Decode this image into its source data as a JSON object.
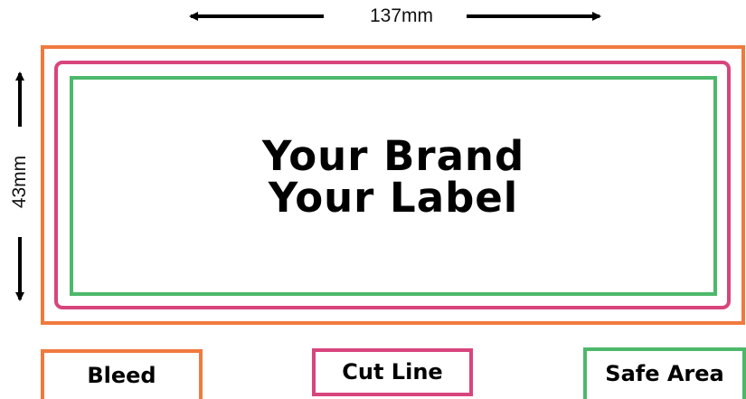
{
  "dimensions": {
    "width": "137mm",
    "height": "43mm"
  },
  "label": {
    "line1": "Your Brand",
    "line2": "Your Label"
  },
  "legend": {
    "bleed": "Bleed",
    "cut_line": "Cut Line",
    "safe_area": "Safe Area"
  },
  "colors": {
    "bleed": "#f07a3e",
    "cut_line": "#d8457d",
    "safe_area": "#4cb96a",
    "arrows": "#000000"
  }
}
